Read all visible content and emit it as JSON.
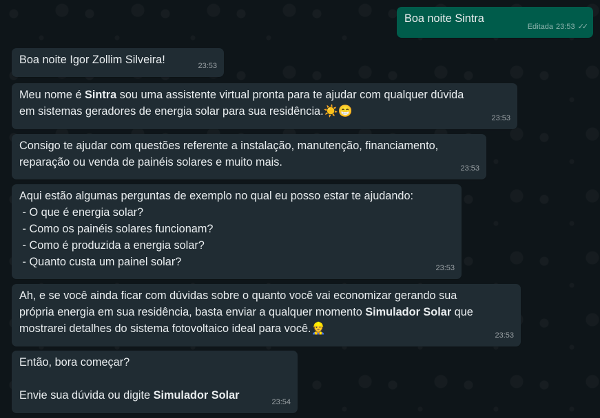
{
  "messages": [
    {
      "id": "m1",
      "dir": "out",
      "text": "Boa noite Sintra",
      "edited_label": "Editada",
      "time": "23:53",
      "status": "read"
    },
    {
      "id": "m2",
      "dir": "in",
      "text": "Boa noite Igor Zollim Silveira!",
      "time": "23:53"
    },
    {
      "id": "m3",
      "dir": "in",
      "parts": [
        "Meu nome é ",
        "Sintra",
        " sou uma assistente virtual pronta para te ajudar com qualquer dúvida\nem sistemas geradores de energia solar para sua residência."
      ],
      "emojis": "☀️😁",
      "time": "23:53"
    },
    {
      "id": "m4",
      "dir": "in",
      "text": "Consigo te ajudar com questões referente a instalação, manutenção, financiamento,\nreparação ou venda de painéis solares e muito mais.",
      "time": "23:53"
    },
    {
      "id": "m5",
      "dir": "in",
      "text": "Aqui estão algumas perguntas de exemplo no qual eu posso estar te ajudando:\n - O que é energia solar?\n - Como os painéis solares funcionam?\n - Como é produzida a energia solar?\n - Quanto custa um painel solar?",
      "time": "23:53"
    },
    {
      "id": "m6",
      "dir": "in",
      "parts": [
        "Ah, e se você ainda ficar com dúvidas sobre o quanto você vai economizar gerando sua\nprópria energia em sua residência, basta enviar a qualquer momento ",
        "Simulador Solar",
        " que\nmostrarei detalhes do sistema fotovoltaico ideal para você."
      ],
      "emojis": "👷",
      "time": "23:53"
    },
    {
      "id": "m7",
      "dir": "in",
      "parts": [
        "Então, bora começar?\n\nEnvie sua dúvida ou digite ",
        "Simulador Solar",
        ""
      ],
      "time": "23:54"
    }
  ],
  "colors": {
    "incoming": "#202c33",
    "outgoing": "#005c4b",
    "text": "#e9edef",
    "background": "#0b141a"
  }
}
